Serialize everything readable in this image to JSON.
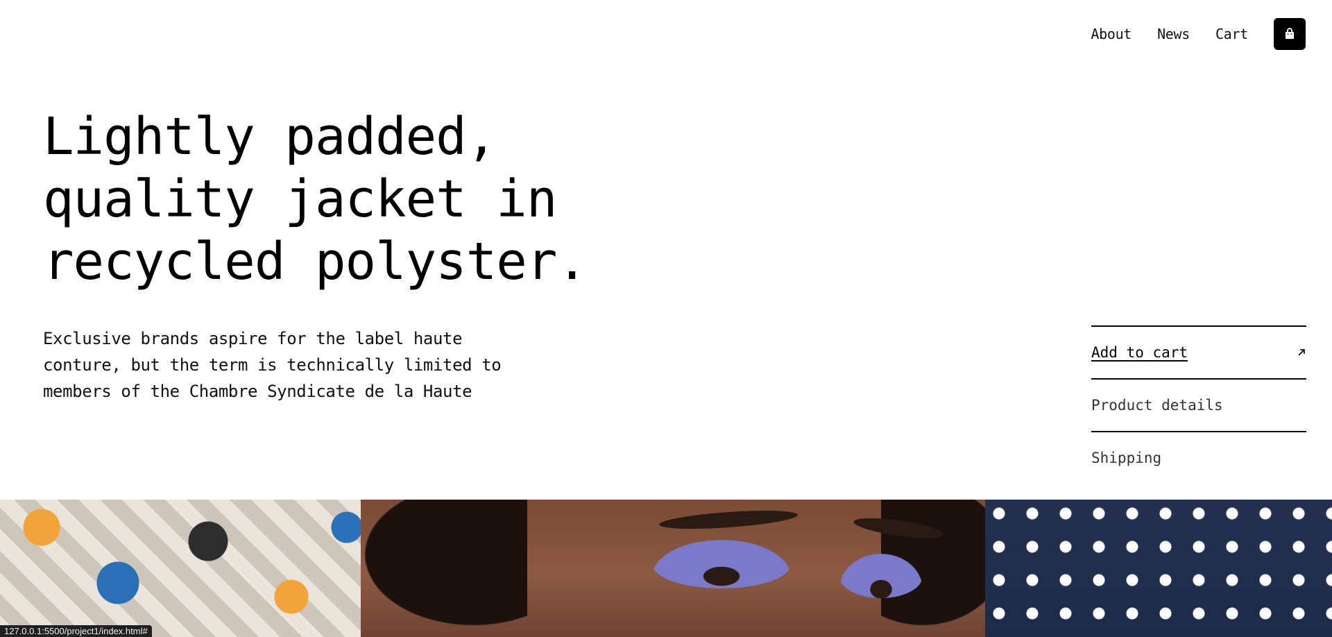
{
  "nav": {
    "links": [
      "About",
      "News",
      "Cart"
    ],
    "cart_icon": "shopping-bag-icon"
  },
  "hero": {
    "title_lines": [
      "Lightly padded,",
      "quality jacket in",
      "recycled polyster."
    ],
    "description_lines": [
      "Exclusive brands aspire for the label haute",
      "conture, but the term is technically limited to",
      "members of the Chambre Syndicate de la Haute"
    ]
  },
  "actions": {
    "add_to_cart": "Add to cart",
    "add_to_cart_icon": "arrow-up-right-icon",
    "product_details": "Product details",
    "shipping": "Shipping"
  },
  "status_bar": {
    "url": "127.0.0.1:5500/project1/index.html#"
  },
  "colors": {
    "background": "#ffffff",
    "text": "#000000",
    "cart_button_bg": "#000000"
  }
}
